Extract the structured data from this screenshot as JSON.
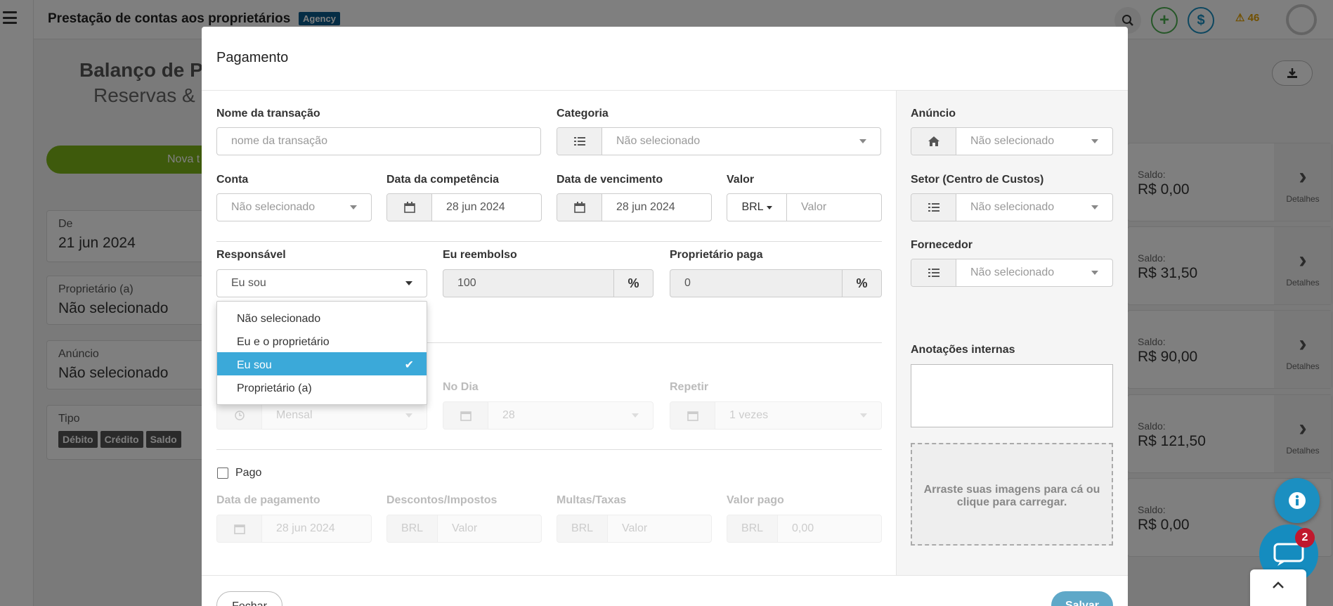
{
  "app": {
    "title": "Prestação de contas aos proprietários",
    "badge": "Agency",
    "warning_count": "46",
    "search_icon": "search-icon",
    "add_icon": "plus-icon",
    "money_icon": "dollar-icon"
  },
  "background": {
    "balance_title": "Balanço de Pr",
    "balance_subtitle": "Reservas & D",
    "new_button": "Nova t",
    "filters": [
      {
        "label": "De",
        "value": "21 jun 2024"
      },
      {
        "label": "Proprietário (a)",
        "value": "Não selecionado"
      },
      {
        "label": "Anúncio",
        "value": "Não selecionado"
      }
    ],
    "type_label": "Tipo",
    "type_tags": [
      "Débito",
      "Crédito",
      "Saldo"
    ],
    "cards": [
      {
        "label": "Saldo:",
        "value": "R$ 0,00",
        "details": "Detalhes"
      },
      {
        "label": "Saldo:",
        "value": "R$ 31,50",
        "details": "Detalhes"
      },
      {
        "label": "Saldo:",
        "value": "R$ 90,00",
        "details": "Detalhes"
      },
      {
        "label": "Saldo:",
        "value": "R$ 121,50",
        "details": "Detalhes"
      },
      {
        "label": "Saldo:",
        "value": "R$ 0,00",
        "details": "Detalhes"
      }
    ]
  },
  "modal": {
    "title": "Pagamento",
    "transaction_name": {
      "label": "Nome da transação",
      "placeholder": "nome da transação"
    },
    "category": {
      "label": "Categoria",
      "value": "Não selecionado"
    },
    "account": {
      "label": "Conta",
      "value": "Não selecionado"
    },
    "competence_date": {
      "label": "Data da competência",
      "value": "28 jun 2024"
    },
    "due_date": {
      "label": "Data de vencimento",
      "value": "28 jun 2024"
    },
    "amount": {
      "label": "Valor",
      "currency": "BRL",
      "placeholder": "Valor"
    },
    "responsible": {
      "label": "Responsável",
      "value": "Eu sou",
      "options": [
        "Não selecionado",
        "Eu e o proprietário",
        "Eu sou",
        "Proprietário (a)"
      ],
      "selected_index": 2
    },
    "i_reimburse": {
      "label": "Eu reembolso",
      "value": "100",
      "unit": "%"
    },
    "owner_pays": {
      "label": "Proprietário paga",
      "value": "0",
      "unit": "%"
    },
    "recurrence": {
      "frequency_value": "Mensal",
      "day_label": "No Dia",
      "day_value": "28",
      "repeat_label": "Repetir",
      "repeat_value": "1 vezes"
    },
    "paid": {
      "label": "Pago",
      "checked": false
    },
    "payment_date": {
      "label": "Data de pagamento",
      "value": "28 jun 2024"
    },
    "discounts": {
      "label": "Descontos/Impostos",
      "currency": "BRL",
      "placeholder": "Valor"
    },
    "fines": {
      "label": "Multas/Taxas",
      "currency": "BRL",
      "placeholder": "Valor"
    },
    "amount_paid": {
      "label": "Valor pago",
      "currency": "BRL",
      "value": "0,00"
    },
    "listing": {
      "label": "Anúncio",
      "value": "Não selecionado"
    },
    "cost_center": {
      "label": "Setor (Centro de Custos)",
      "value": "Não selecionado"
    },
    "supplier": {
      "label": "Fornecedor",
      "value": "Não selecionado"
    },
    "internal_notes": {
      "label": "Anotações internas",
      "value": ""
    },
    "upload_text": "Arraste suas imagens para cá ou clique para carregar.",
    "close_button": "Fechar",
    "save_button": "Salvar"
  },
  "floating": {
    "chat_badge": "2"
  },
  "colors": {
    "accent_blue": "#3ba9d9",
    "brand_green": "#7cb518",
    "agency_badge": "#0a5a8a",
    "chat_blue": "#158cbf",
    "badge_red": "#c0182d"
  }
}
